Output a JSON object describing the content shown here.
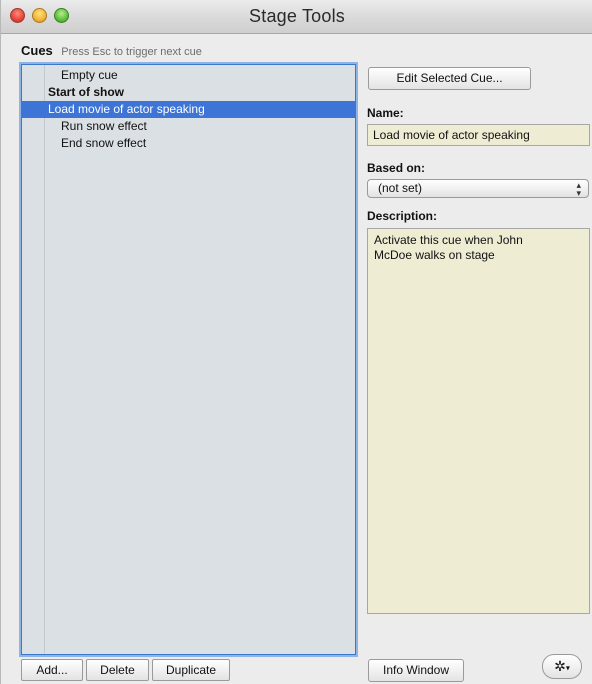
{
  "window": {
    "title": "Stage Tools"
  },
  "cues": {
    "label": "Cues",
    "hint": "Press Esc to trigger next cue",
    "items": [
      {
        "label": "Empty cue",
        "kind": "child"
      },
      {
        "label": "Start of show",
        "kind": "group"
      },
      {
        "label": "Load movie of actor speaking",
        "kind": "child",
        "selected": true
      },
      {
        "label": "Run snow effect",
        "kind": "child"
      },
      {
        "label": "End snow effect",
        "kind": "child"
      }
    ],
    "buttons": {
      "add": "Add...",
      "delete": "Delete",
      "duplicate": "Duplicate"
    }
  },
  "editor": {
    "edit_button": "Edit Selected Cue...",
    "name_label": "Name:",
    "name_value": "Load movie of actor speaking",
    "based_on_label": "Based on:",
    "based_on_value": "(not set)",
    "description_label": "Description:",
    "description_value": "Activate this cue when John\nMcDoe walks on stage",
    "info_button": "Info Window",
    "gear_icon": "gear-icon"
  },
  "colors": {
    "selection": "#3d74d6",
    "field_background": "#efecd4",
    "list_background": "#dbe0e5",
    "focus_ring": "#3b78c9"
  }
}
